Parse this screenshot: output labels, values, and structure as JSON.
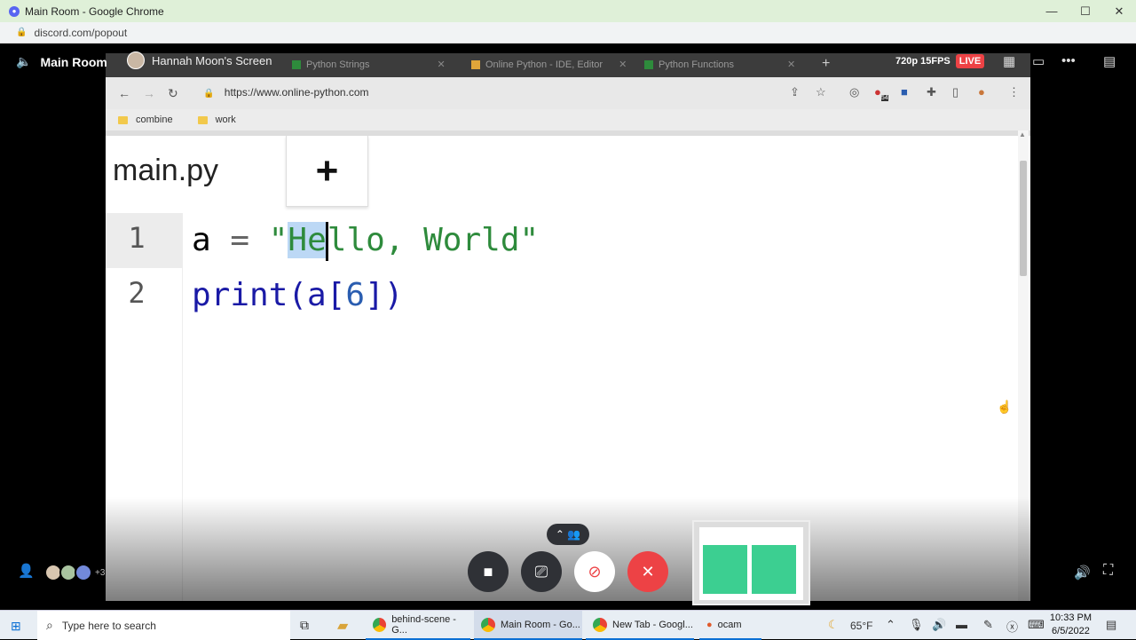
{
  "window": {
    "title": "Main Room - Google Chrome",
    "url": "discord.com/popout"
  },
  "discord": {
    "room_name": "Main Room",
    "streamer": "Hannah Moon's Screen",
    "quality": "720p 15FPS",
    "live_badge": "LIVE",
    "extra_participants": "+3"
  },
  "shared_browser": {
    "tabs": [
      {
        "label": "Python Strings"
      },
      {
        "label": "Online Python - IDE, Editor"
      },
      {
        "label": "Python Functions"
      }
    ],
    "address": "https://www.online-python.com",
    "bookmarks": [
      {
        "label": "combine"
      },
      {
        "label": "work"
      }
    ],
    "ext_badge": "54"
  },
  "editor": {
    "file_tab": "main.py",
    "add_tab": "+",
    "line_numbers": [
      "1",
      "2"
    ],
    "line1": {
      "var": "a",
      "op": " = ",
      "q1": "\"",
      "sel": "He",
      "rest": "llo, World",
      "q2": "\""
    },
    "line2": {
      "func": "print(a[",
      "num": "6",
      "end": "])"
    }
  },
  "taskbar": {
    "search_placeholder": "Type here to search",
    "apps": [
      {
        "label": "behind-scene - G..."
      },
      {
        "label": "Main Room - Go..."
      },
      {
        "label": "New Tab - Googl..."
      },
      {
        "label": "ocam"
      }
    ],
    "weather": "65°F",
    "time": "10:33 PM",
    "date": "6/5/2022"
  },
  "colors": {
    "live": "#ed4245",
    "hangup": "#ed4245",
    "string": "#2e8b3c",
    "keyword": "#1a1aa6"
  }
}
